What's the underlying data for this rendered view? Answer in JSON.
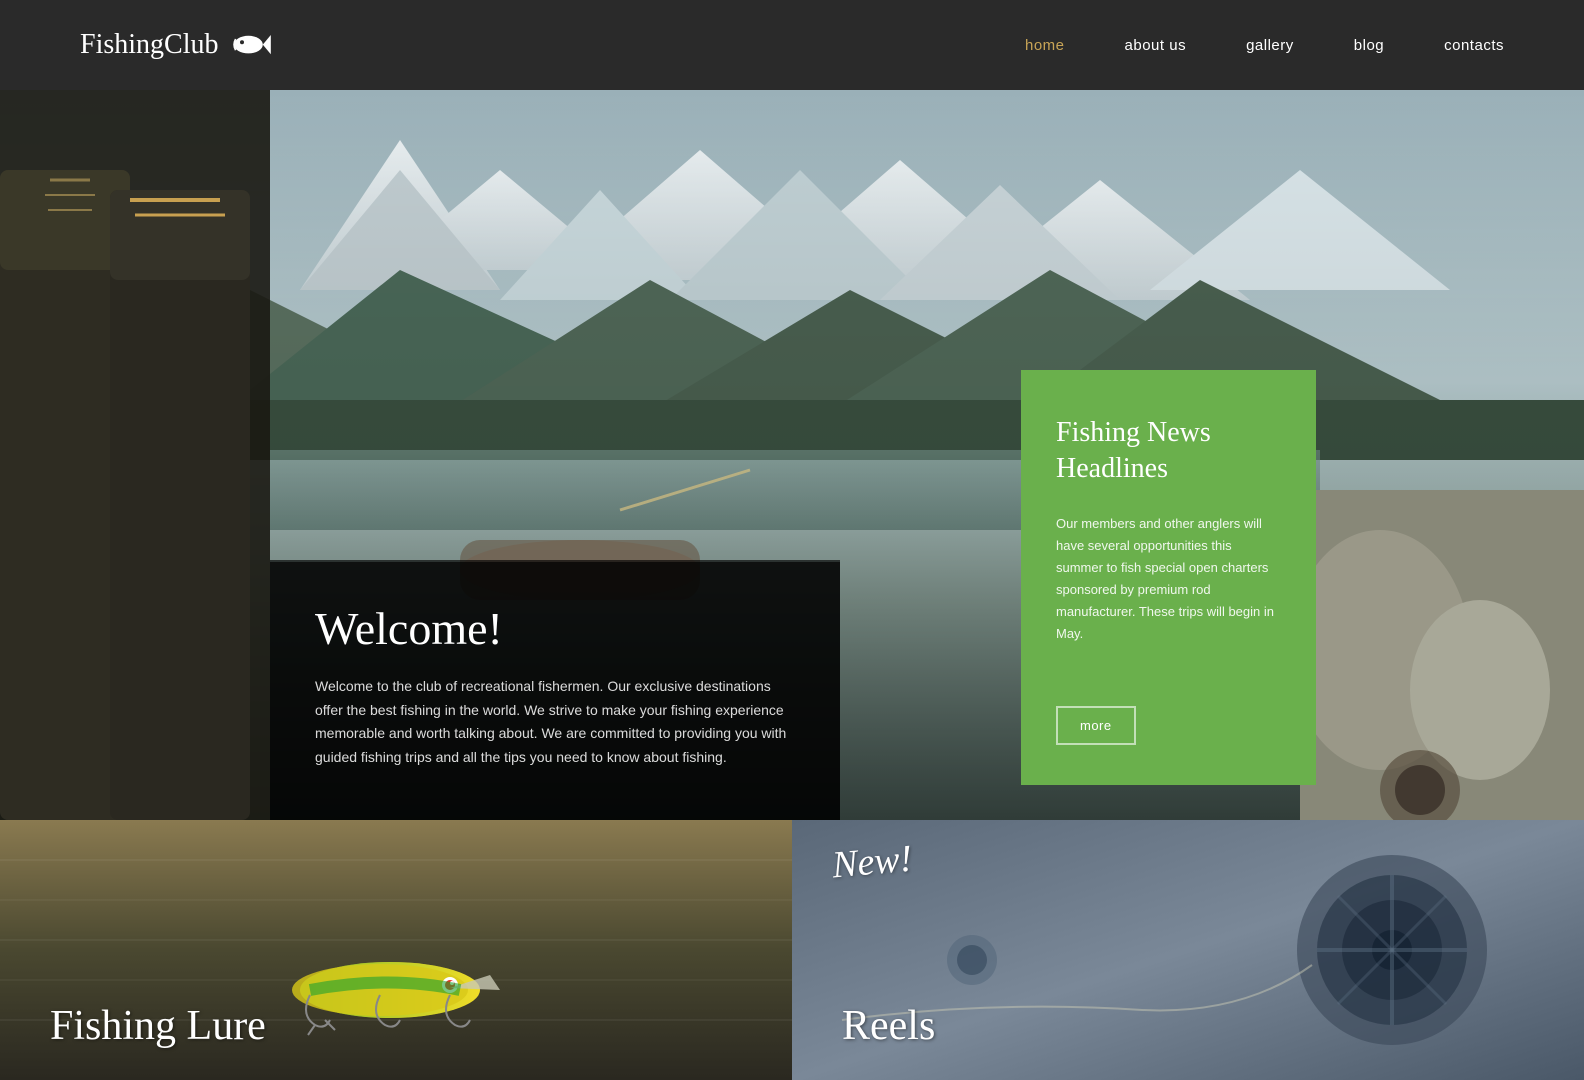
{
  "header": {
    "logo_text": "FishingClub",
    "nav": {
      "home": "home",
      "about": "about us",
      "gallery": "gallery",
      "blog": "blog",
      "contacts": "contacts"
    }
  },
  "hero": {
    "welcome_title": "Welcome!",
    "welcome_description": "Welcome to the club of recreational fishermen. Our exclusive destinations offer the best fishing in the world. We strive to make your fishing experience memorable and worth talking about. We are committed to providing you with guided fishing trips and all the tips you need to know about fishing."
  },
  "news_panel": {
    "title": "Fishing News Headlines",
    "body": "Our members and other anglers will have several opportunities this summer to fish special open charters sponsored by premium rod manufacturer. These trips will begin in May.",
    "more_btn": "more"
  },
  "cards": {
    "left_label": "Fishing Lure",
    "right_new": "New!",
    "right_label": "Reels"
  },
  "colors": {
    "nav_active": "#c8a456",
    "header_bg": "#2a2a2a",
    "news_green": "#6ab04c"
  }
}
